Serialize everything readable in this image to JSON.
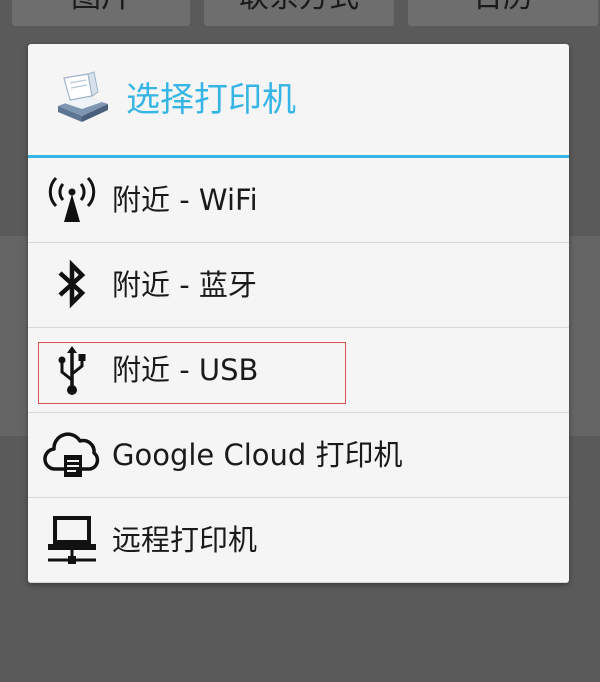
{
  "background": {
    "tabs": [
      "图片",
      "联系方式",
      "日历"
    ]
  },
  "dialog": {
    "title": "选择打印机",
    "accent_color": "#35b5e5",
    "options": [
      {
        "icon": "wifi-antenna-icon",
        "label": "附近 - WiFi"
      },
      {
        "icon": "bluetooth-icon",
        "label": "附近 - 蓝牙"
      },
      {
        "icon": "usb-icon",
        "label": "附近 - USB",
        "highlighted": true
      },
      {
        "icon": "cloud-printer-icon",
        "label": "Google Cloud 打印机"
      },
      {
        "icon": "network-computer-icon",
        "label": "远程打印机"
      }
    ]
  }
}
